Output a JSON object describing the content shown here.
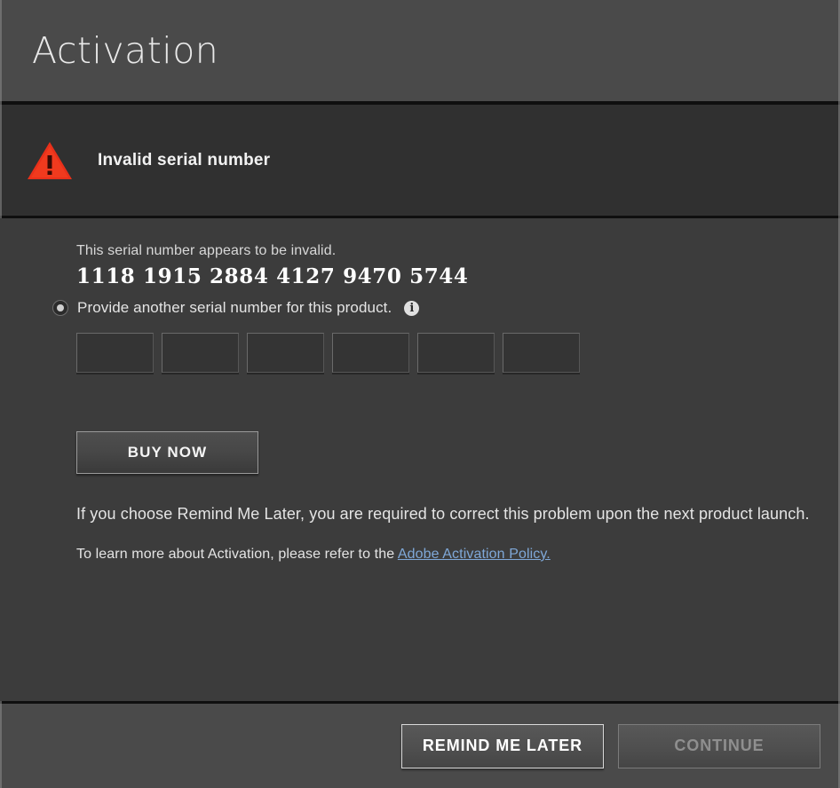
{
  "dialog": {
    "title": "Activation"
  },
  "warning": {
    "icon": "warning-triangle-icon",
    "message": "Invalid serial number"
  },
  "body": {
    "invalid_notice": "This serial number appears to be invalid.",
    "serial_number": "1118 1915 2884 4127 9470 5744",
    "radio": {
      "label": "Provide another serial number for this product.",
      "selected": true,
      "info_icon_glyph": "i"
    },
    "serial_input_groups": [
      {
        "value": "",
        "placeholder": ""
      },
      {
        "value": "",
        "placeholder": ""
      },
      {
        "value": "",
        "placeholder": ""
      },
      {
        "value": "",
        "placeholder": ""
      },
      {
        "value": "",
        "placeholder": ""
      },
      {
        "value": "",
        "placeholder": ""
      }
    ],
    "buy_now_label": "BUY NOW",
    "remind_note": "If you choose Remind Me Later, you are required to correct this problem upon the next product launch.",
    "learn_more_prefix": "To learn more about Activation, please refer to the ",
    "learn_more_link": "Adobe Activation Policy."
  },
  "footer": {
    "remind_label": "REMIND ME LATER",
    "continue_label": "CONTINUE",
    "continue_enabled": false
  },
  "colors": {
    "header_bg": "#4a4a4a",
    "warning_bg": "#303030",
    "body_bg": "#3c3c3c",
    "footer_bg": "#4a4a4a",
    "warning_red": "#e8301a",
    "link_blue": "#7fa8d8",
    "disabled_text": "#8f8f8f"
  }
}
